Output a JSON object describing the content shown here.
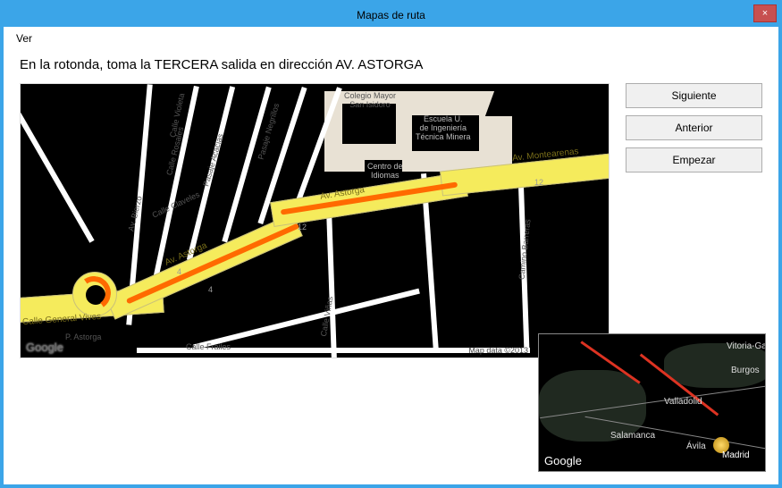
{
  "window": {
    "title": "Mapas de ruta",
    "close": "×"
  },
  "menu": {
    "ver": "Ver"
  },
  "instruction": "En la rotonda, toma la TERCERA salida en dirección AV. ASTORGA",
  "buttons": {
    "next": "Siguiente",
    "prev": "Anterior",
    "start": "Empezar"
  },
  "map": {
    "logo": "Google",
    "attribution": "Map data ©2013",
    "roads": {
      "vives": "Calle General Vives",
      "astorga": "Av. Astorga",
      "montearenas": "Av. Montearenas",
      "bierzo": "Av. Bierzo"
    },
    "streets": {
      "violeta": "Calle Violeta",
      "rosales": "Calle Rosales",
      "acacias": "Pasaje Acacias",
      "negrillos": "Pasaje Negrillos",
      "claveles": "Calle Claveles",
      "frailes": "Calle Frailes",
      "vinas": "Calle Viñas",
      "barreras": "Camino Barreras",
      "p_astorga": "P. Astorga"
    },
    "poi": {
      "colegio": "Colegio Mayor\nSan Isidoro",
      "escuela": "Escuela U.\nde Ingeniería\nTécnica Minera",
      "idiomas": "Centro de\nIdiomas"
    },
    "nums": {
      "n4a": "4",
      "n4b": "4",
      "n12a": "12",
      "n12b": "12"
    }
  },
  "minimap": {
    "logo": "Google",
    "cities": {
      "madrid": "Madrid",
      "valladolid": "Valladolid",
      "salamanca": "Salamanca",
      "burgos": "Burgos",
      "vitoria": "Vitoria-Ga",
      "avila": "Ávila"
    }
  }
}
